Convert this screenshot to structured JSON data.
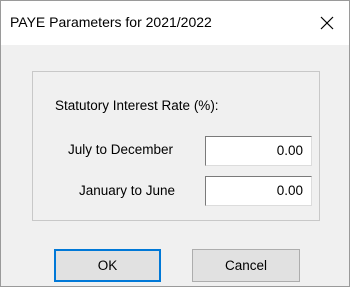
{
  "window": {
    "title": "PAYE Parameters for 2021/2022",
    "close_icon": "close-icon"
  },
  "group": {
    "label": "Statutory Interest Rate (%):",
    "rows": [
      {
        "label": "July to December",
        "value": "0.00"
      },
      {
        "label": "January to June",
        "value": "0.00"
      }
    ]
  },
  "buttons": {
    "ok_label": "OK",
    "cancel_label": "Cancel"
  },
  "colors": {
    "dialog_bg": "#f0f0f0",
    "titlebar_bg": "#ffffff",
    "default_button_border": "#0078d7"
  }
}
